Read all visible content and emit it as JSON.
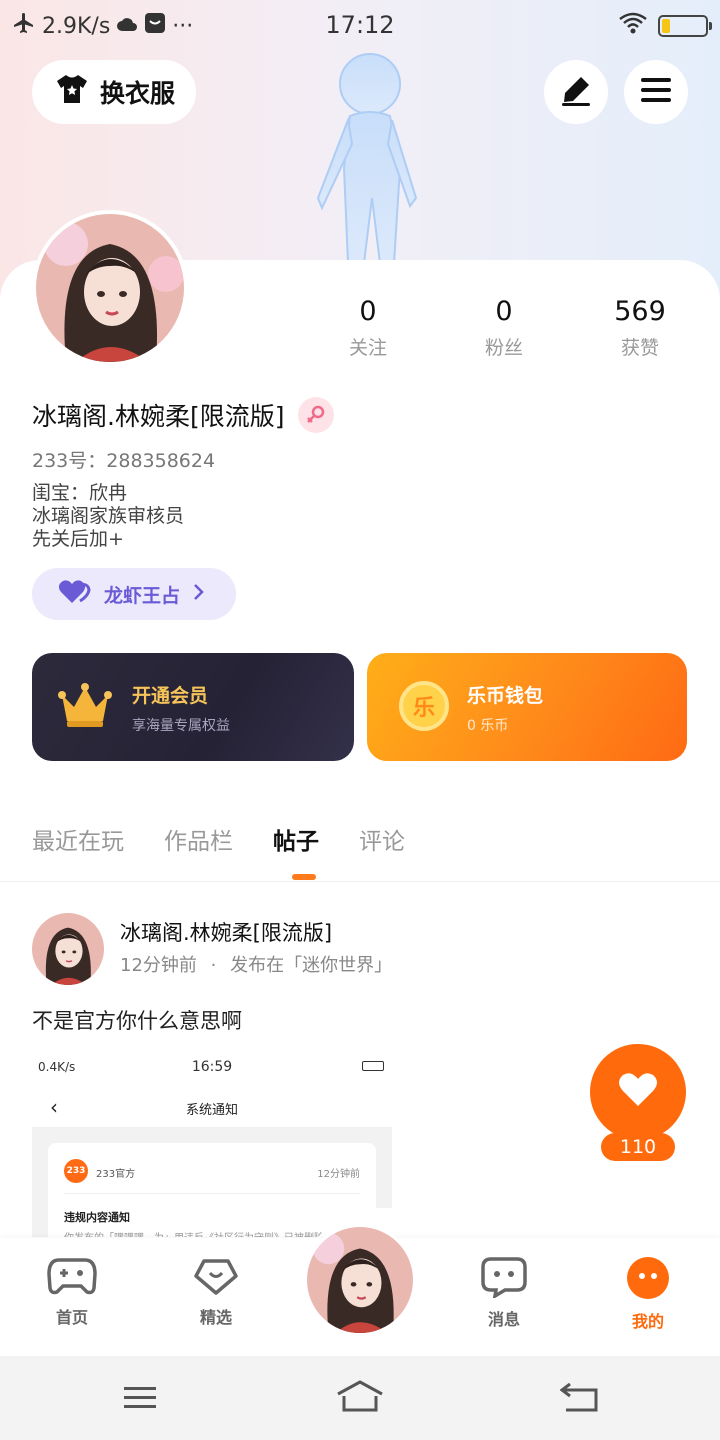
{
  "status_bar": {
    "speed": "2.9K/s",
    "time": "17:12",
    "more": "···",
    "battery_level": 0.2,
    "colors": {
      "battery_fill": "#f5c518"
    }
  },
  "header": {
    "dress_button_label": "换衣服"
  },
  "profile": {
    "stats": [
      {
        "value": "0",
        "label": "关注"
      },
      {
        "value": "0",
        "label": "粉丝"
      },
      {
        "value": "569",
        "label": "获赞"
      }
    ],
    "username": "冰璃阁.林婉柔[限流版]",
    "uid": "233号：288358624",
    "bio": [
      "闺宝：欣冉",
      "冰璃阁家族审核员",
      "先关后加+"
    ],
    "tag_label": "龙虾王占"
  },
  "cards": {
    "vip": {
      "title": "开通会员",
      "subtitle": "享海量专属权益"
    },
    "wallet": {
      "title": "乐币钱包",
      "subtitle": "0 乐币",
      "coin_glyph": "乐"
    }
  },
  "tabs": [
    {
      "label": "最近在玩",
      "active": false
    },
    {
      "label": "作品栏",
      "active": false
    },
    {
      "label": "帖子",
      "active": true
    },
    {
      "label": "评论",
      "active": false
    }
  ],
  "post": {
    "author": "冰璃阁.林婉柔[限流版]",
    "time": "12分钟前",
    "separator": "·",
    "location": "发布在「迷你世界」",
    "text": "不是官方你什么意思啊",
    "screenshot": {
      "speed": "0.4K/s",
      "time": "16:59",
      "title": "系统通知",
      "sender_logo": "233",
      "sender": "233官方",
      "sent_time": "12分钟前",
      "body_title": "违规内容通知",
      "body_preview": "你发布的「嘿嘿嘿，为」用违反《社区行为守则》已被删除"
    },
    "like_count": "110"
  },
  "bottom_nav": [
    {
      "label": "首页",
      "icon": "gamepad-icon",
      "active": false
    },
    {
      "label": "精选",
      "icon": "heart-badge-icon",
      "active": false
    },
    {
      "label": "消息",
      "icon": "chat-bubble-icon",
      "active": false
    },
    {
      "label": "我的",
      "icon": "profile-face-icon",
      "active": true
    }
  ],
  "colors": {
    "accent": "#ff6a0d",
    "vip_card": "#2c2a3b",
    "wallet_card": "#ff8a1a",
    "tag_bg": "#ebe9fb",
    "tag_text": "#6a5ad6"
  }
}
